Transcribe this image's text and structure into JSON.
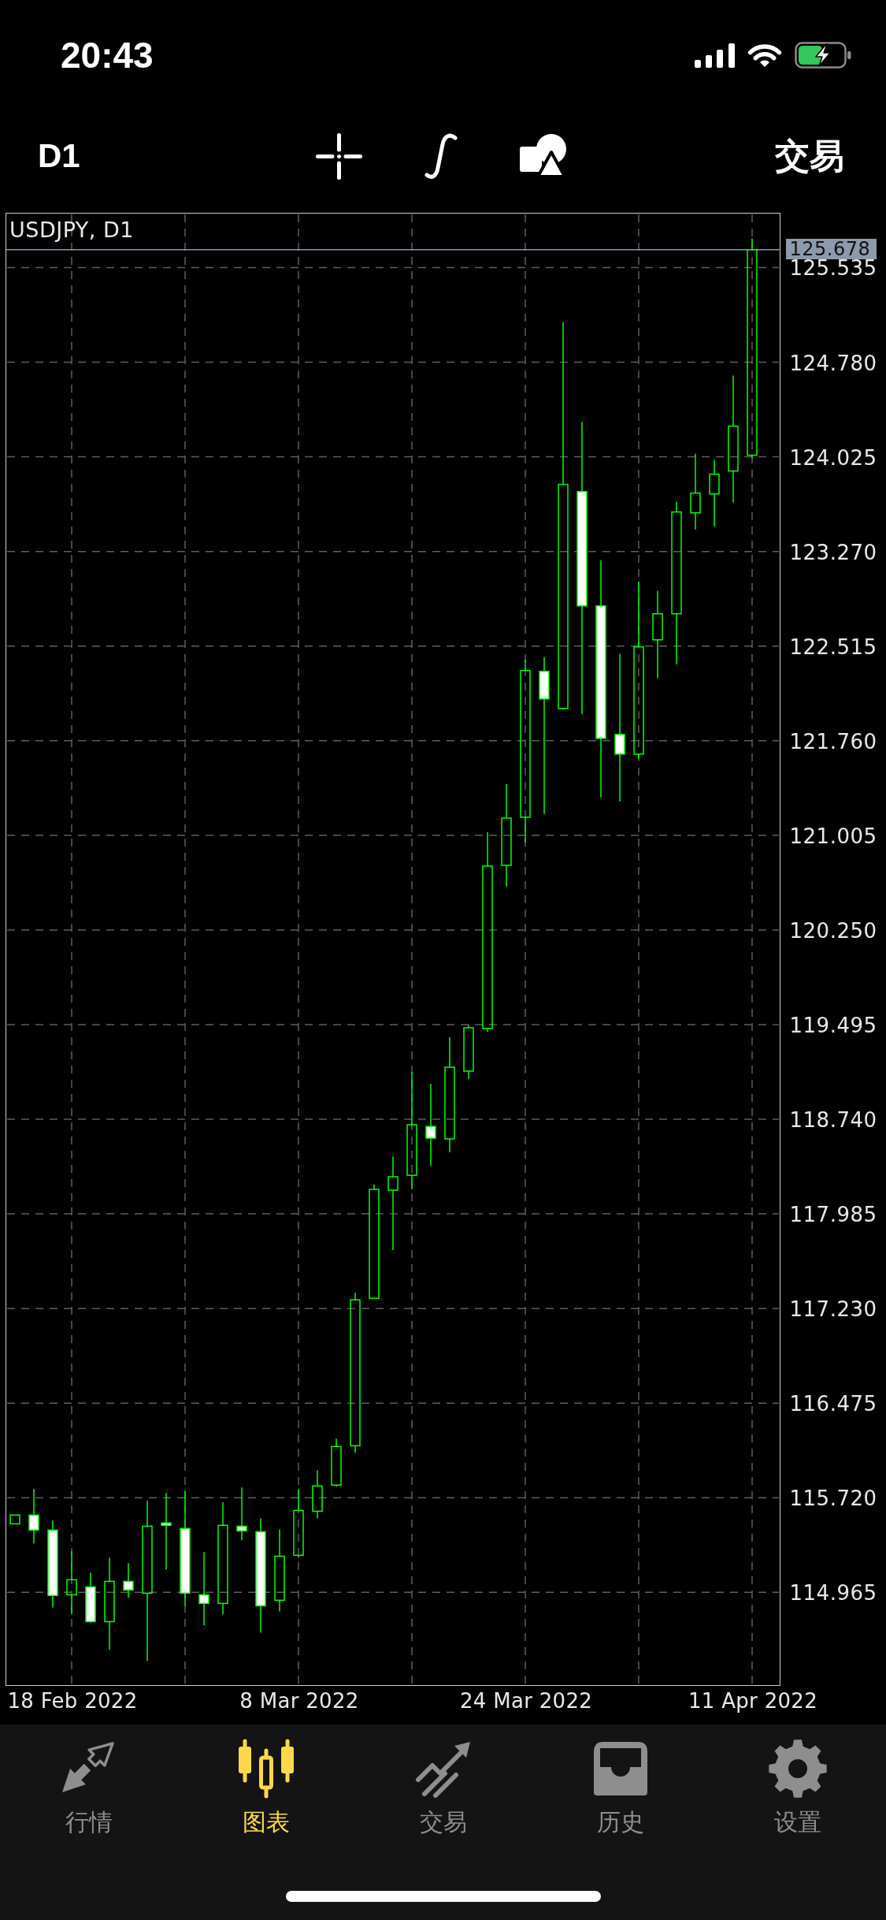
{
  "status_bar": {
    "time": "20:43"
  },
  "toolbar": {
    "timeframe": "D1",
    "trade_button": "交易"
  },
  "chart": {
    "chart_data": {
      "type": "candlestick",
      "title": "USDJPY, D1",
      "categories": [
        null,
        null,
        null,
        "18 Feb 2022",
        null,
        null,
        null,
        null,
        null,
        null,
        null,
        null,
        null,
        null,
        null,
        "8 Mar 2022",
        null,
        null,
        null,
        null,
        null,
        null,
        null,
        null,
        null,
        null,
        null,
        "24 Mar 2022",
        null,
        null,
        null,
        null,
        null,
        null,
        null,
        null,
        null,
        null,
        null,
        "11 Apr 2022",
        null
      ],
      "ohlc": [
        [
          115.512,
          115.582,
          115.512,
          115.582
        ],
        [
          115.582,
          115.789,
          115.355,
          115.462
        ],
        [
          115.462,
          115.538,
          114.845,
          114.94
        ],
        [
          114.946,
          115.292,
          114.789,
          115.066
        ],
        [
          115.009,
          115.122,
          114.72,
          114.732
        ],
        [
          114.732,
          115.242,
          114.506,
          115.053
        ],
        [
          115.053,
          115.198,
          114.921,
          114.984
        ],
        [
          114.959,
          115.695,
          114.418,
          115.493
        ],
        [
          115.519,
          115.758,
          115.147,
          115.5
        ],
        [
          115.475,
          115.777,
          114.858,
          114.959
        ],
        [
          114.946,
          115.286,
          114.701,
          114.877
        ],
        [
          114.877,
          115.682,
          114.789,
          115.5
        ],
        [
          115.493,
          115.802,
          115.38,
          115.456
        ],
        [
          115.449,
          115.556,
          114.644,
          114.858
        ],
        [
          114.902,
          115.468,
          114.814,
          115.254
        ],
        [
          115.261,
          115.789,
          115.242,
          115.619
        ],
        [
          115.613,
          115.94,
          115.556,
          115.814
        ],
        [
          115.821,
          116.192,
          115.808,
          116.129
        ],
        [
          116.135,
          117.356,
          116.079,
          117.299
        ],
        [
          117.312,
          118.218,
          117.312,
          118.18
        ],
        [
          118.174,
          118.444,
          117.696,
          118.281
        ],
        [
          118.293,
          119.118,
          118.18,
          118.696
        ],
        [
          118.683,
          119.023,
          118.369,
          118.589
        ],
        [
          118.583,
          119.394,
          118.476,
          119.155
        ],
        [
          119.124,
          119.495,
          119.061,
          119.47
        ],
        [
          119.464,
          121.03,
          119.438,
          120.76
        ],
        [
          120.766,
          121.414,
          120.596,
          121.143
        ],
        [
          121.15,
          122.408,
          120.948,
          122.32
        ],
        [
          122.314,
          122.427,
          121.175,
          122.093
        ],
        [
          122.018,
          125.101,
          122.012,
          123.805
        ],
        [
          123.748,
          124.302,
          121.974,
          122.836
        ],
        [
          122.836,
          123.201,
          121.307,
          121.779
        ],
        [
          121.81,
          122.452,
          121.276,
          121.653
        ],
        [
          121.653,
          123.031,
          121.615,
          122.509
        ],
        [
          122.565,
          122.955,
          122.257,
          122.773
        ],
        [
          122.773,
          123.666,
          122.37,
          123.585
        ],
        [
          123.578,
          124.05,
          123.446,
          123.736
        ],
        [
          123.729,
          124.0,
          123.471,
          123.887
        ],
        [
          123.912,
          124.673,
          123.66,
          124.27
        ],
        [
          124.038,
          125.768,
          124.012,
          125.678
        ],
        null
      ],
      "ylim": [
        114.219,
        125.972
      ],
      "yticks": [
        {
          "value": 125.535,
          "label": "125.535"
        },
        {
          "value": 124.78,
          "label": "124.780"
        },
        {
          "value": 124.025,
          "label": "124.025"
        },
        {
          "value": 123.27,
          "label": "123.270"
        },
        {
          "value": 122.515,
          "label": "122.515"
        },
        {
          "value": 121.76,
          "label": "121.760"
        },
        {
          "value": 121.005,
          "label": "121.005"
        },
        {
          "value": 120.25,
          "label": "120.250"
        },
        {
          "value": 119.495,
          "label": "119.495"
        },
        {
          "value": 118.74,
          "label": "118.740"
        },
        {
          "value": 117.985,
          "label": "117.985"
        },
        {
          "value": 117.23,
          "label": "117.230"
        },
        {
          "value": 116.475,
          "label": "116.475"
        },
        {
          "value": 115.72,
          "label": "115.720"
        },
        {
          "value": 114.965,
          "label": "114.965"
        }
      ],
      "grid": true,
      "ref_lines": [
        {
          "axis": "y",
          "value": 125.678,
          "label": "125.678"
        }
      ]
    }
  },
  "tabs": [
    {
      "label": "行情",
      "kind": "quotes",
      "selected": false
    },
    {
      "label": "图表",
      "kind": "chart",
      "selected": true
    },
    {
      "label": "交易",
      "kind": "trade",
      "selected": false
    },
    {
      "label": "历史",
      "kind": "history",
      "selected": false
    },
    {
      "label": "设置",
      "kind": "settings",
      "selected": false
    }
  ]
}
